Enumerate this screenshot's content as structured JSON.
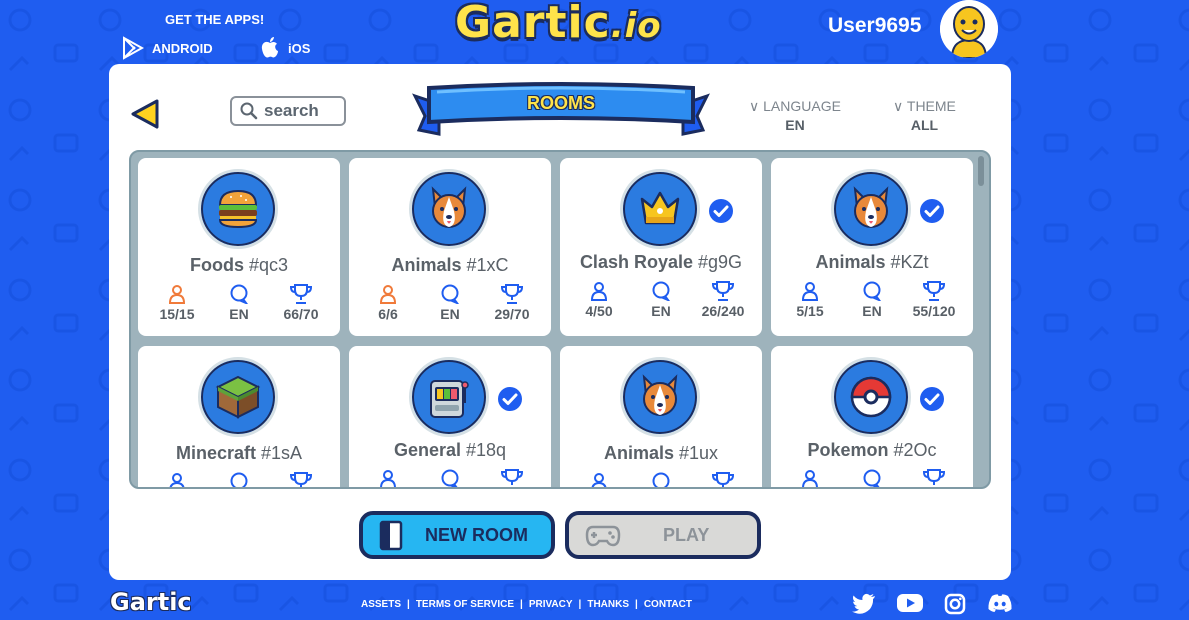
{
  "header": {
    "get_apps": "GET THE APPS!",
    "android": "ANDROID",
    "ios": "iOS",
    "logo": "Gartic",
    "logo_suffix": ".io",
    "username": "User9695"
  },
  "panel": {
    "search_placeholder": "search",
    "title": "ROOMS",
    "language_label": "LANGUAGE",
    "language_value": "EN",
    "theme_label": "THEME",
    "theme_value": "ALL"
  },
  "rooms": [
    {
      "name": "Foods",
      "code": "#qc3",
      "players": "15/15",
      "lang": "EN",
      "points": "66/70",
      "full": true,
      "verified": false,
      "icon": "burger-icon"
    },
    {
      "name": "Animals",
      "code": "#1xC",
      "players": "6/6",
      "lang": "EN",
      "points": "29/70",
      "full": true,
      "verified": false,
      "icon": "corgi-icon"
    },
    {
      "name": "Clash Royale",
      "code": "#g9G",
      "players": "4/50",
      "lang": "EN",
      "points": "26/240",
      "full": false,
      "verified": true,
      "icon": "crown-icon"
    },
    {
      "name": "Animals",
      "code": "#KZt",
      "players": "5/15",
      "lang": "EN",
      "points": "55/120",
      "full": false,
      "verified": true,
      "icon": "corgi-icon"
    },
    {
      "name": "Minecraft",
      "code": "#1sA",
      "players": "",
      "lang": "",
      "points": "",
      "full": false,
      "verified": false,
      "icon": "grass-block-icon"
    },
    {
      "name": "General",
      "code": "#18q",
      "players": "",
      "lang": "",
      "points": "",
      "full": false,
      "verified": true,
      "icon": "slot-machine-icon"
    },
    {
      "name": "Animals",
      "code": "#1ux",
      "players": "",
      "lang": "",
      "points": "",
      "full": false,
      "verified": false,
      "icon": "corgi-icon"
    },
    {
      "name": "Pokemon",
      "code": "#2Oc",
      "players": "",
      "lang": "",
      "points": "",
      "full": false,
      "verified": true,
      "icon": "pokeball-icon"
    }
  ],
  "buttons": {
    "new_room": "NEW ROOM",
    "play": "PLAY"
  },
  "footer": {
    "logo": "Gartic",
    "links": [
      "ASSETS",
      "TERMS OF SERVICE",
      "PRIVACY",
      "THANKS",
      "CONTACT"
    ]
  },
  "colors": {
    "background": "#1f5df0",
    "accent_yellow": "#ffe34a",
    "new_room": "#26b6f2",
    "full_room": "#f07a3a",
    "verified": "#1f5df0"
  }
}
